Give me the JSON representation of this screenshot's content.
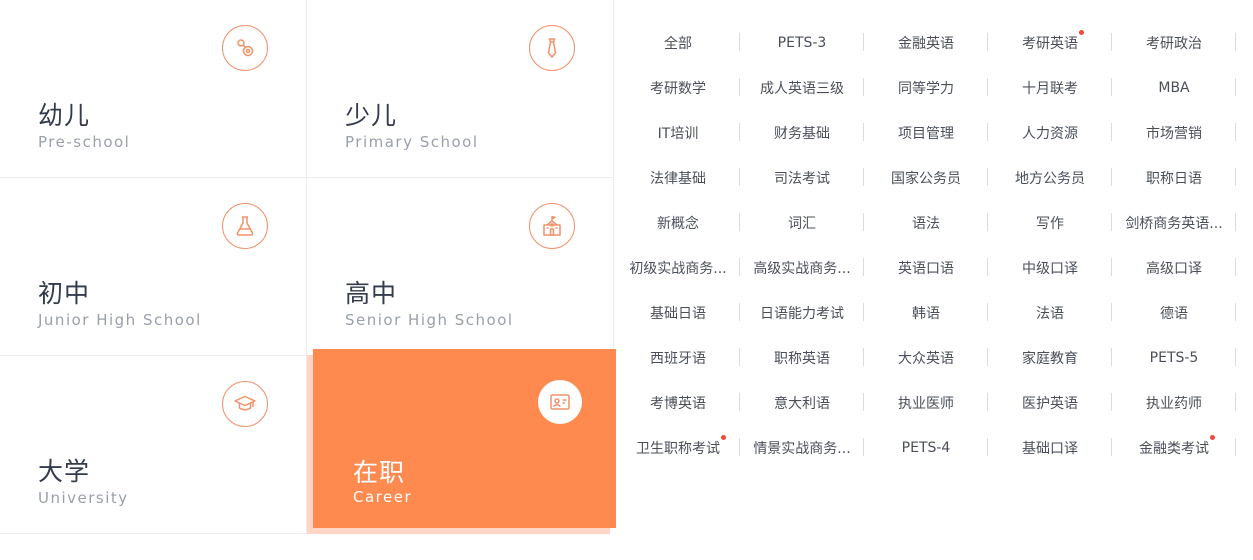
{
  "categories": [
    {
      "cn": "幼儿",
      "en": "Pre-school",
      "icon": "pacifier-icon"
    },
    {
      "cn": "少儿",
      "en": "Primary School",
      "icon": "tie-icon"
    },
    {
      "cn": "初中",
      "en": "Junior High School",
      "icon": "flask-icon"
    },
    {
      "cn": "高中",
      "en": "Senior High School",
      "icon": "school-building-icon"
    },
    {
      "cn": "大学",
      "en": "University",
      "icon": "graduation-cap-icon"
    },
    {
      "cn": "在职",
      "en": "Career",
      "icon": "id-card-icon"
    }
  ],
  "tags": [
    {
      "label": "全部"
    },
    {
      "label": "PETS-3"
    },
    {
      "label": "金融英语"
    },
    {
      "label": "考研英语",
      "dot": true
    },
    {
      "label": "考研政治"
    },
    {
      "label": "考研数学"
    },
    {
      "label": "成人英语三级"
    },
    {
      "label": "同等学力"
    },
    {
      "label": "十月联考"
    },
    {
      "label": "MBA"
    },
    {
      "label": "IT培训"
    },
    {
      "label": "财务基础"
    },
    {
      "label": "项目管理"
    },
    {
      "label": "人力资源"
    },
    {
      "label": "市场营销"
    },
    {
      "label": "法律基础"
    },
    {
      "label": "司法考试"
    },
    {
      "label": "国家公务员"
    },
    {
      "label": "地方公务员"
    },
    {
      "label": "职称日语"
    },
    {
      "label": "新概念"
    },
    {
      "label": "词汇"
    },
    {
      "label": "语法"
    },
    {
      "label": "写作"
    },
    {
      "label": "剑桥商务英语..."
    },
    {
      "label": "初级实战商务..."
    },
    {
      "label": "高级实战商务..."
    },
    {
      "label": "英语口语"
    },
    {
      "label": "中级口译"
    },
    {
      "label": "高级口译"
    },
    {
      "label": "基础日语"
    },
    {
      "label": "日语能力考试"
    },
    {
      "label": "韩语"
    },
    {
      "label": "法语"
    },
    {
      "label": "德语"
    },
    {
      "label": "西班牙语"
    },
    {
      "label": "职称英语"
    },
    {
      "label": "大众英语"
    },
    {
      "label": "家庭教育"
    },
    {
      "label": "PETS-5"
    },
    {
      "label": "考博英语"
    },
    {
      "label": "意大利语"
    },
    {
      "label": "执业医师"
    },
    {
      "label": "医护英语"
    },
    {
      "label": "执业药师"
    },
    {
      "label": "卫生职称考试",
      "dot": true
    },
    {
      "label": "情景实战商务..."
    },
    {
      "label": "PETS-4"
    },
    {
      "label": "基础口译"
    },
    {
      "label": "金融类考试",
      "dot": true
    }
  ],
  "colors": {
    "accent": "#ff8a4f",
    "icon_stroke": "#f0936a",
    "dot": "#f04a3a"
  }
}
